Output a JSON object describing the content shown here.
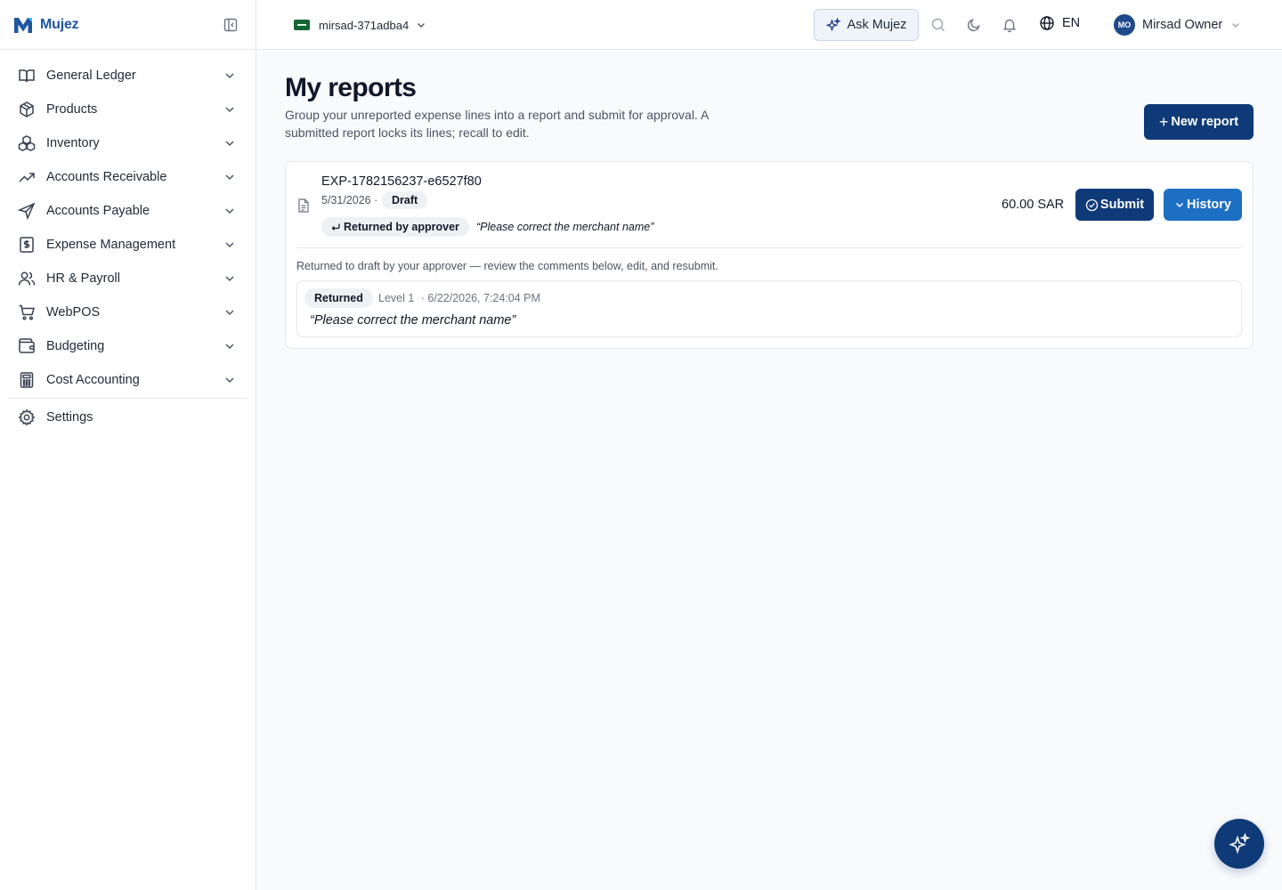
{
  "brand": {
    "name": "Mujez"
  },
  "sidebar": {
    "items": [
      {
        "label": "General Ledger",
        "icon": "book-open-icon"
      },
      {
        "label": "Products",
        "icon": "package-icon"
      },
      {
        "label": "Inventory",
        "icon": "boxes-icon"
      },
      {
        "label": "Accounts Receivable",
        "icon": "trending-up-icon"
      },
      {
        "label": "Accounts Payable",
        "icon": "send-icon"
      },
      {
        "label": "Expense Management",
        "icon": "receipt-icon"
      },
      {
        "label": "HR & Payroll",
        "icon": "users-icon"
      },
      {
        "label": "WebPOS",
        "icon": "cart-icon"
      },
      {
        "label": "Budgeting",
        "icon": "wallet-icon"
      },
      {
        "label": "Cost Accounting",
        "icon": "calculator-icon"
      }
    ],
    "settings_label": "Settings"
  },
  "topbar": {
    "org_name": "mirsad-371adba4",
    "ask_label": "Ask Mujez",
    "language": "EN",
    "user_initials": "MO",
    "user_name": "Mirsad Owner"
  },
  "page": {
    "title": "My reports",
    "description": "Group your unreported expense lines into a report and submit for approval. A submitted report locks its lines; recall to edit.",
    "new_button": "New report"
  },
  "report": {
    "id": "EXP-1782156237-e6527f80",
    "date": "5/31/2026 ·",
    "status": "Draft",
    "returned_badge": "Returned by approver",
    "returned_comment": "“Please correct the merchant name”",
    "amount": "60.00 SAR",
    "submit_label": "Submit",
    "history_label": "History",
    "return_note": "Returned to draft by your approver — review the comments below, edit, and resubmit.",
    "history_entry": {
      "status": "Returned",
      "level": "Level 1",
      "timestamp": "· 6/22/2026, 7:24:04 PM",
      "comment": "“Please correct the merchant name”"
    }
  },
  "colors": {
    "primary": "#0f3a78",
    "accent": "#1d6fc4",
    "brand": "#1e56a0"
  }
}
